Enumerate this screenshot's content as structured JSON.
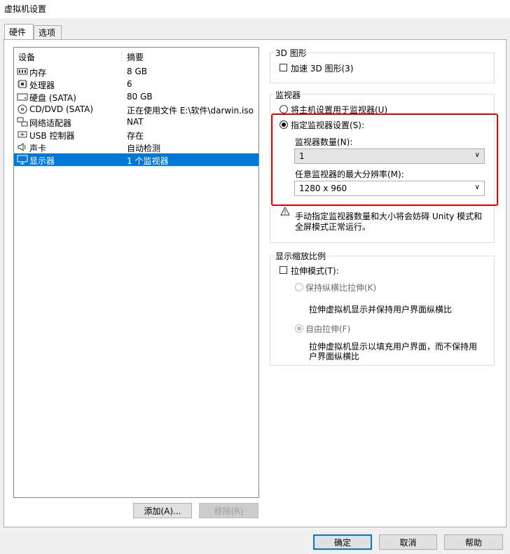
{
  "window": {
    "title": "虚拟机设置"
  },
  "tabs": [
    {
      "label": "硬件"
    },
    {
      "label": "选项"
    }
  ],
  "device_list": {
    "columns": [
      "设备",
      "摘要"
    ],
    "rows": [
      {
        "name": "内存",
        "summary": "8 GB",
        "icon": "memory-icon"
      },
      {
        "name": "处理器",
        "summary": "6",
        "icon": "cpu-icon"
      },
      {
        "name": "硬盘 (SATA)",
        "summary": "80 GB",
        "icon": "harddisk-icon"
      },
      {
        "name": "CD/DVD (SATA)",
        "summary": "正在使用文件 E:\\软件\\darwin.iso",
        "icon": "cd-icon"
      },
      {
        "name": "网络适配器",
        "summary": "NAT",
        "icon": "network-icon"
      },
      {
        "name": "USB 控制器",
        "summary": "存在",
        "icon": "usb-icon"
      },
      {
        "name": "声卡",
        "summary": "自动检测",
        "icon": "speaker-icon"
      },
      {
        "name": "显示器",
        "summary": "1 个监视器",
        "icon": "monitor-icon",
        "selected": true
      }
    ],
    "add_button": "添加(A)...",
    "remove_button": "移除(R)"
  },
  "graphics_3d": {
    "group_label": "3D 图形",
    "accelerate_label": "加速 3D 图形(3)",
    "checked": false
  },
  "monitors": {
    "group_label": "监视器",
    "host_radio": "将主机设置用于监视器(U)",
    "specify_radio": "指定监视器设置(S):",
    "selected": "specify",
    "count_label": "监视器数量(N):",
    "count_value": "1",
    "maxres_label": "任意监视器的最大分辨率(M):",
    "maxres_value": "1280 x 960",
    "warning_line1": "手动指定监视器数量和大小将会妨碍 Unity 模式和",
    "warning_line2": "全屏模式正常运行。"
  },
  "scaling": {
    "group_label": "显示缩放比例",
    "stretch_label": "拉伸模式(T):",
    "stretch_checked": false,
    "keep_aspect": "保持纵横比拉伸(K)",
    "keep_aspect_desc": "拉伸虚拟机显示并保持用户界面纵横比",
    "free_stretch": "自由拉伸(F)",
    "free_stretch_desc1": "拉伸虚拟机显示以填充用户界面，而不保持用",
    "free_stretch_desc2": "户界面纵横比"
  },
  "footer": {
    "ok": "确定",
    "cancel": "取消",
    "help": "帮助"
  },
  "colors": {
    "selection": "#0078d7",
    "highlight_border": "#e60000"
  }
}
